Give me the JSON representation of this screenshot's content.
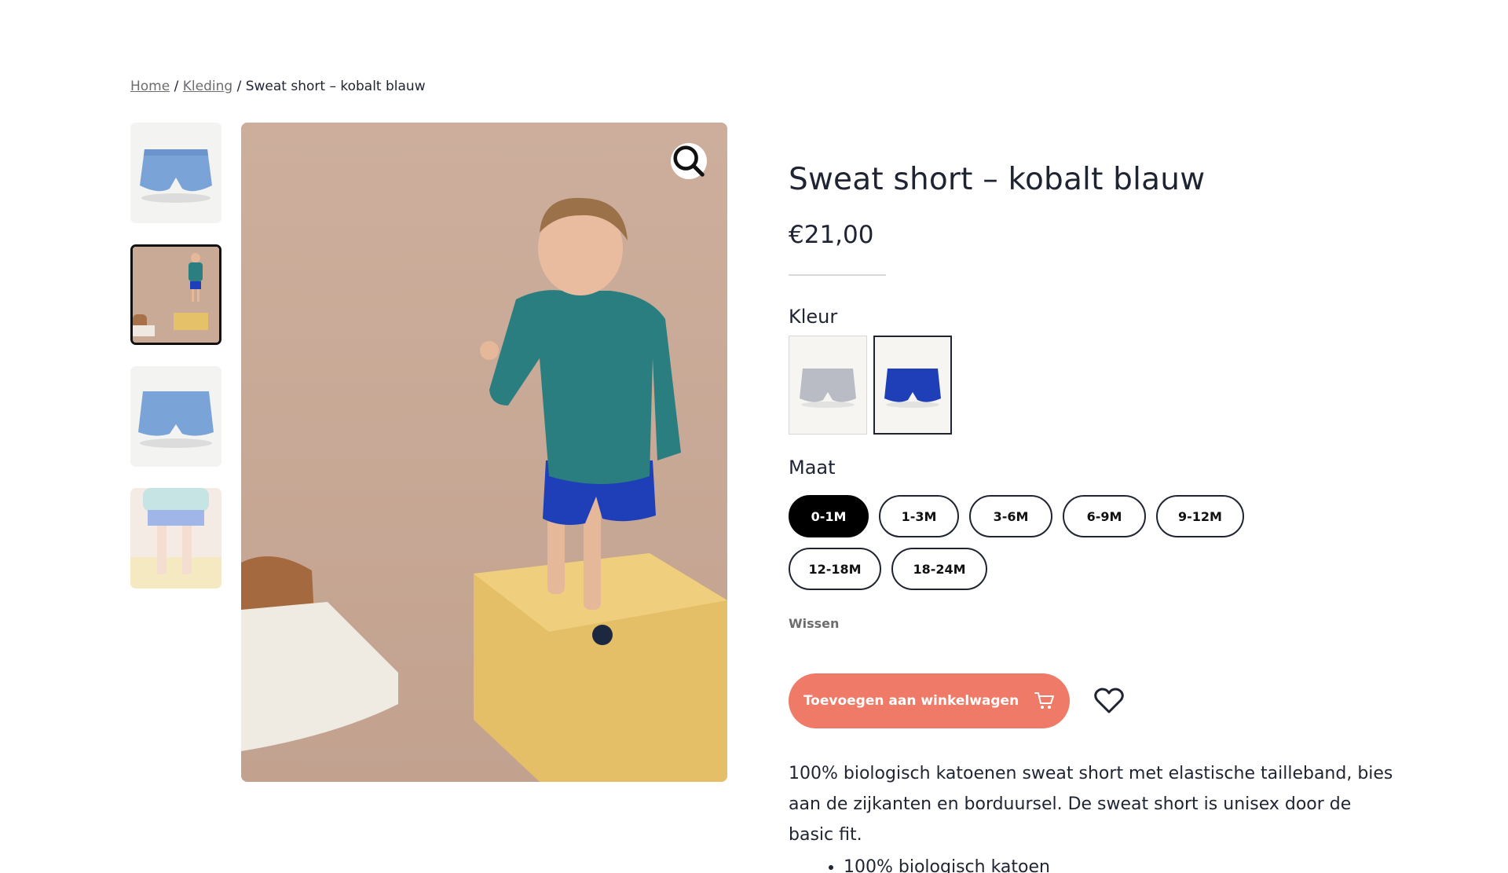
{
  "breadcrumb": {
    "home": "Home",
    "category": "Kleding",
    "separator": "/",
    "current": "Sweat short – kobalt blauw"
  },
  "gallery": {
    "thumbnails": [
      {
        "alt": "light blue short flat"
      },
      {
        "alt": "child on yellow block"
      },
      {
        "alt": "light blue short back"
      },
      {
        "alt": "child legs in blue short"
      }
    ],
    "zoom_icon": "magnifier-icon"
  },
  "product": {
    "title": "Sweat short – kobalt blauw",
    "price": "€21,00",
    "color_label": "Kleur",
    "size_label": "Maat",
    "sizes": [
      "0-1M",
      "1-3M",
      "3-6M",
      "6-9M",
      "9-12M",
      "12-18M",
      "18-24M"
    ],
    "selected_size": "0-1M",
    "clear_label": "Wissen",
    "add_to_cart": "Toevoegen aan winkelwagen",
    "cart_icon": "cart-icon",
    "wishlist_icon": "heart-icon",
    "description": "100% biologisch katoenen sweat short met elastische tailleband, bies aan de zijkanten en borduursel. De sweat short is unisex door de basic fit.",
    "bullets": [
      "100% biologisch katoen"
    ]
  },
  "colors": {
    "cta": "#f07a68",
    "text": "#1f2433",
    "cobalt": "#1f3fb8",
    "grey_swatch": "#b9bcc4"
  }
}
